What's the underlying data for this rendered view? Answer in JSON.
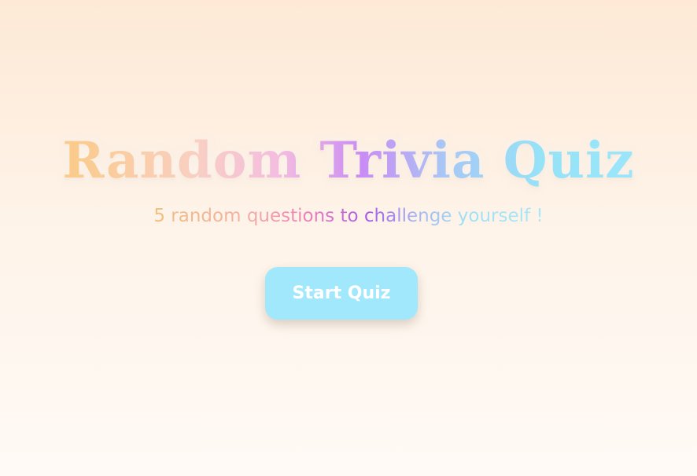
{
  "main": {
    "title": "Random Trivia Quiz",
    "subtitle": "5 random questions to challenge yourself !",
    "start_button_label": "Start Quiz"
  }
}
